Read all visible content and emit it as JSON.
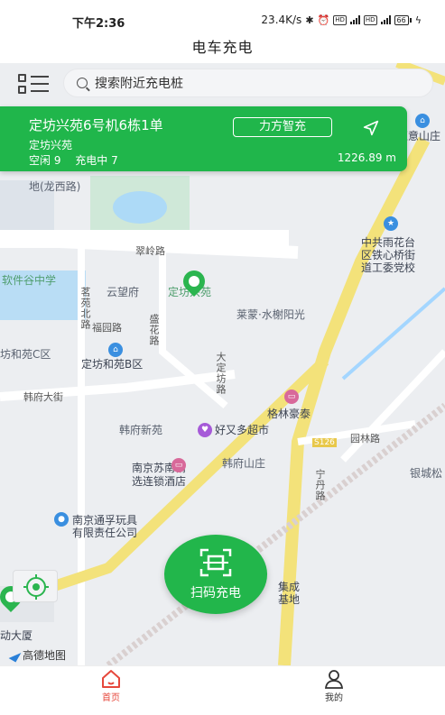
{
  "status_bar": {
    "time": "下午2:36",
    "speed": "23.4K/s",
    "battery": "66"
  },
  "header": {
    "title": "电车充电"
  },
  "search": {
    "placeholder": "搜索附近充电桩"
  },
  "station": {
    "name": "定坊兴苑6号机6栋1单",
    "community": "定坊兴苑",
    "idle": "空闲 9",
    "charging": "充电中 7",
    "brand_tag": "力方智充",
    "distance": "1226.89 m"
  },
  "map": {
    "labels": {
      "longxi": "地(龙西路)",
      "cuiling": "翠岭路",
      "software": "软件谷中学",
      "yunwang": "云望府",
      "dingfang": "定坊兴苑",
      "mingbei": "茗苑北路",
      "fucheng": "福园路",
      "shenghua": "盛花路",
      "lemeng": "莱蒙·水榭阳光",
      "hefang_c": "坊和苑C区",
      "dingfang_b": "定坊和苑B区",
      "dading": "大定坊路",
      "hanfu_st": "韩府大街",
      "hanfu_xin": "韩府新苑",
      "haoyouduo": "好又多超市",
      "gelin": "格林豪泰",
      "hanfu_sz": "韩府山庄",
      "sunan_1": "南京苏南精",
      "sunan_2": "选连锁酒店",
      "s126": "S126",
      "yuanlin": "园林路",
      "ningdan": "宁丹路",
      "yinte": "银城松",
      "toy_1": "南京通孚玩具",
      "toy_2": "有限责任公司",
      "cpc_1": "中共雨花台",
      "cpc_2": "区铁心桥街",
      "cpc_3": "道工委党校",
      "huishan": "汇意山庄",
      "jicheng": "集成",
      "jidi": "基地",
      "dasha": "动大厦"
    }
  },
  "scan_button": {
    "label": "扫码充电"
  },
  "amap": {
    "label": "高德地图"
  },
  "bottom_nav": {
    "home": "首页",
    "me": "我的"
  }
}
